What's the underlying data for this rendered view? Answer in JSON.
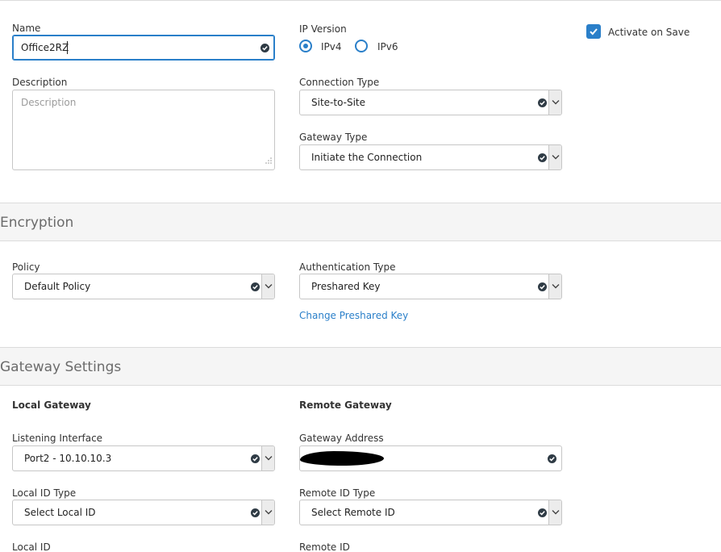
{
  "general": {
    "name_label": "Name",
    "name_value": "Office2RZ",
    "description_label": "Description",
    "description_placeholder": "Description",
    "ip_version_label": "IP Version",
    "ipv4_label": "IPv4",
    "ipv6_label": "IPv6",
    "ip_version_selected": "IPv4",
    "activate_label": "Activate on Save",
    "activate_checked": true,
    "connection_type_label": "Connection Type",
    "connection_type_value": "Site-to-Site",
    "gateway_type_label": "Gateway Type",
    "gateway_type_value": "Initiate the Connection"
  },
  "encryption": {
    "section_title": "Encryption",
    "policy_label": "Policy",
    "policy_value": "Default Policy",
    "auth_type_label": "Authentication Type",
    "auth_type_value": "Preshared Key",
    "change_key_link": "Change Preshared Key"
  },
  "gateway": {
    "section_title": "Gateway Settings",
    "local_heading": "Local Gateway",
    "remote_heading": "Remote Gateway",
    "listening_interface_label": "Listening Interface",
    "listening_interface_value": "Port2 - 10.10.10.3",
    "gateway_address_label": "Gateway Address",
    "local_id_type_label": "Local ID Type",
    "local_id_type_value": "Select Local ID",
    "remote_id_type_label": "Remote ID Type",
    "remote_id_type_value": "Select Remote ID",
    "local_id_label": "Local ID",
    "remote_id_label": "Remote ID"
  },
  "colors": {
    "accent": "#2a7fc9",
    "section_band": "#f5f5f5",
    "section_title": "#6b6b6b"
  }
}
